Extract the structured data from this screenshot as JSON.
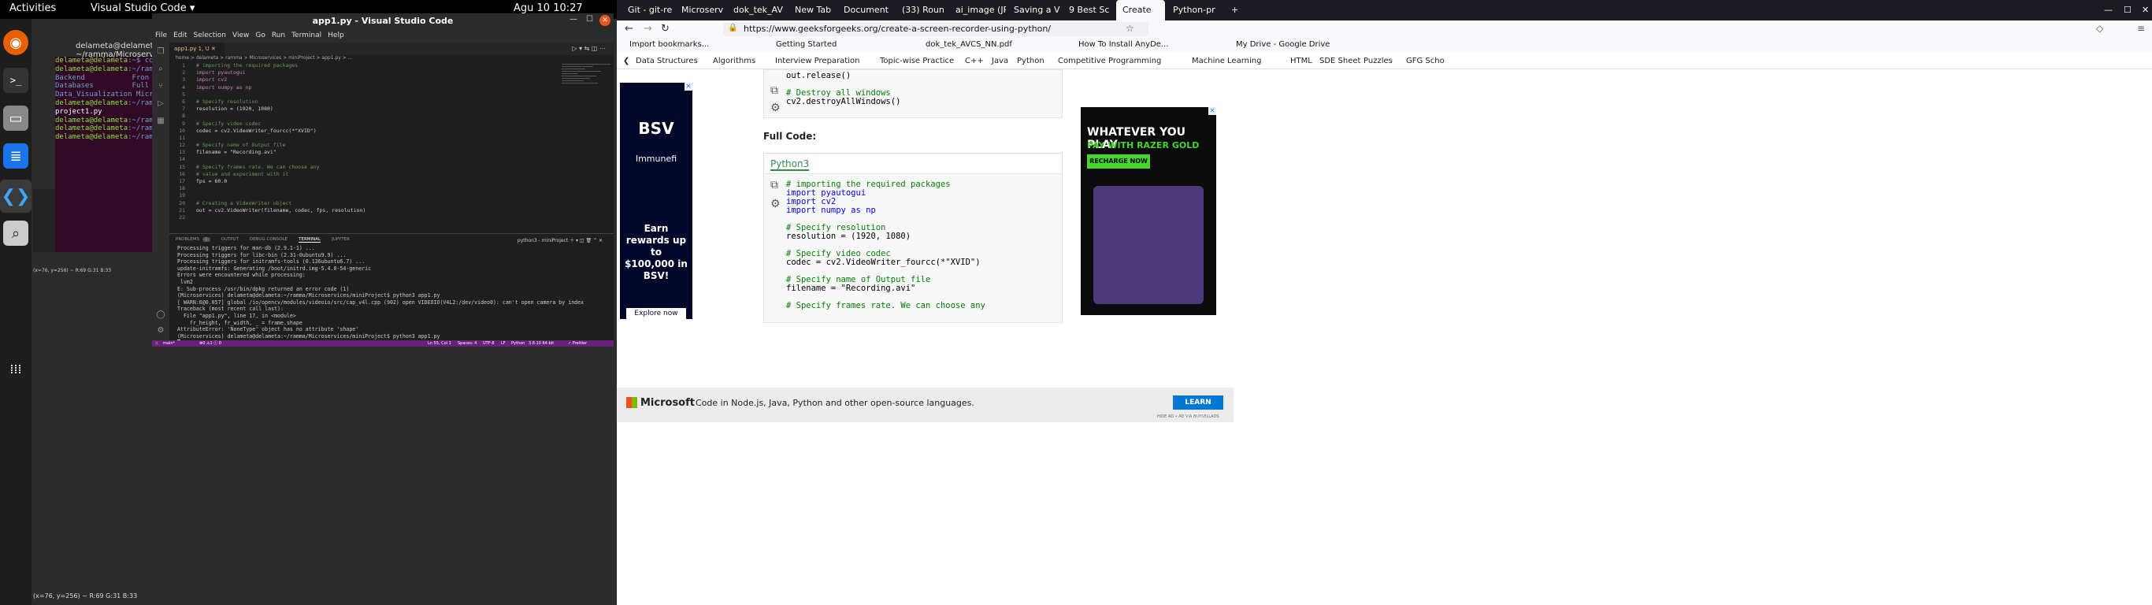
{
  "topbar": {
    "activities": "Activities",
    "app": "Visual Studio Code ▾",
    "clock": "Agu 10  10:27"
  },
  "dock": {
    "apps": [
      "firefox-icon",
      "terminal-icon",
      "files-icon",
      "writer-icon",
      "vscode-icon",
      "search-app-icon",
      "apps-grid-icon"
    ]
  },
  "terminal": {
    "title": "delameta@delameta: ~/ramma/Microservices",
    "lines": [
      {
        "p": "delameta@delameta",
        "s": ":~$ cd"
      },
      {
        "p": "delameta@delameta",
        "s": ":~/ramm"
      },
      {
        "c": "Backend           Fron"
      },
      {
        "c": "Databases         Full"
      },
      {
        "c": "Data_Visualization Micr"
      },
      {
        "p": "delameta@delameta",
        "s": ":~/ramm"
      },
      {
        "t": "project1.py"
      },
      {
        "p": "delameta@delameta",
        "s": ":~/ramm"
      },
      {
        "p": "delameta@delameta",
        "s": ":~/ramm"
      },
      {
        "p": "delameta@delameta",
        "s": ":~/ramm"
      }
    ],
    "coords": "(x=76, y=256) ~ R:69 G:31 B:33"
  },
  "vscode": {
    "title": "app1.py - Visual Studio Code",
    "menu": [
      "File",
      "Edit",
      "Selection",
      "View",
      "Go",
      "Run",
      "Terminal",
      "Help"
    ],
    "tab": "app1.py  1, U",
    "breadcrumb": "home > delameta > ramma > Microservices > miniProject > app1.py > ...",
    "panel_tabs": [
      "PROBLEMS",
      "OUTPUT",
      "DEBUG CONSOLE",
      "TERMINAL",
      "JUPYTER"
    ],
    "panel_count": "1",
    "panel_shell": "python3 - miniProject",
    "terminal_lines": [
      "Processing triggers for man-db (2.9.1-1) ...",
      "Processing triggers for libc-bin (2.31-0ubuntu9.9) ...",
      "Processing triggers for initramfs-tools (0.136ubuntu6.7) ...",
      "update-initramfs: Generating /boot/initrd.img-5.4.0-54-generic",
      "Errors were encountered while processing:",
      " lvm2",
      "E: Sub-process /usr/bin/dpkg returned an error code (1)",
      "(Microservices) delameta@delameta:~/ramma/Microservices/miniProject$ python3 app1.py",
      "[ WARN:0@0.057] global /io/opencv/modules/videoio/src/cap_v4l.cpp (902) open VIDEOIO(V4L2:/dev/video0): can't open camera by index",
      "Traceback (most recent call last):",
      "  File \"app1.py\", line 17, in <module>",
      "    fr_height, fr_width, _ = frame.shape",
      "AttributeError: 'NoneType' object has no attribute 'shape'",
      "(Microservices) delameta@delameta:~/ramma/Microservices/miniProject$ python3 app1.py"
    ],
    "status": {
      "branch": "main*",
      "errors": "⊗0 ⚠1 ⓘ 0",
      "position": "Ln 55, Col 1",
      "spaces": "Spaces: 4",
      "enc": "UTF-8",
      "eol": "LF",
      "lang": "Python",
      "interp": "3.8.10 64-bit",
      "prettier": "✓ Prettier"
    }
  },
  "code": [
    {
      "n": "1",
      "t": "# importing the required packages",
      "k": "cm"
    },
    {
      "n": "2",
      "t": "import pyautogui",
      "k": "imp"
    },
    {
      "n": "3",
      "t": "import cv2",
      "k": "imp"
    },
    {
      "n": "4",
      "t": "import numpy as np",
      "k": "imp"
    },
    {
      "n": "5",
      "t": "",
      "k": "id"
    },
    {
      "n": "6",
      "t": "# Specify resolution",
      "k": "cm"
    },
    {
      "n": "7",
      "t": "resolution = (1920, 1080)",
      "k": "id"
    },
    {
      "n": "8",
      "t": "",
      "k": "id"
    },
    {
      "n": "9",
      "t": "# Specify video codec",
      "k": "cm"
    },
    {
      "n": "10",
      "t": "codec = cv2.VideoWriter_fourcc(*\"XVID\")",
      "k": "id"
    },
    {
      "n": "11",
      "t": "",
      "k": "id"
    },
    {
      "n": "12",
      "t": "# Specify name of Output file",
      "k": "cm"
    },
    {
      "n": "13",
      "t": "filename = \"Recording.avi\"",
      "k": "id"
    },
    {
      "n": "14",
      "t": "",
      "k": "id"
    },
    {
      "n": "15",
      "t": "# Specify frames rate. We can choose any",
      "k": "cm"
    },
    {
      "n": "16",
      "t": "# value and experiment with it",
      "k": "cm"
    },
    {
      "n": "17",
      "t": "fps = 60.0",
      "k": "id"
    },
    {
      "n": "18",
      "t": "",
      "k": "id"
    },
    {
      "n": "19",
      "t": "",
      "k": "id"
    },
    {
      "n": "20",
      "t": "# Creating a VideoWriter object",
      "k": "cm"
    },
    {
      "n": "21",
      "t": "out = cv2.VideoWriter(filename, codec, fps, resolution)",
      "k": "id"
    },
    {
      "n": "22",
      "t": "",
      "k": "id"
    }
  ],
  "browser": {
    "tabs": [
      "Git - git-re",
      "Microserv",
      "dok_tek_AV",
      "New Tab",
      "Document",
      "(33) Roun",
      "ai_image (JP",
      "Saving a V",
      "9 Best Sc",
      "Create",
      "Python-pr"
    ],
    "active_tab": 9,
    "url": "https://www.geeksforgeeks.org/create-a-screen-recorder-using-python/",
    "bookmarks": [
      "Import bookmarks...",
      "Getting Started",
      "dok_tek_AVCS_NN.pdf",
      "How To Install AnyDe...",
      "My Drive - Google Drive"
    ],
    "topics": [
      "Data Structures",
      "Algorithms",
      "Interview Preparation",
      "Topic-wise Practice",
      "C++",
      "Java",
      "Python",
      "Competitive Programming",
      "Machine Learning",
      "HTML",
      "SDE Sheet",
      "Puzzles",
      "GFG Scho"
    ],
    "snippet_top": [
      "out.release()",
      "",
      "# Destroy all windows",
      "cv2.destroyAllWindows()"
    ],
    "full_code_label": "Full Code:",
    "lang_tab": "Python3",
    "snippet": [
      "# importing the required packages",
      "import pyautogui",
      "import cv2",
      "import numpy as np",
      "",
      "# Specify resolution",
      "resolution = (1920, 1080)",
      "",
      "# Specify video codec",
      "codec = cv2.VideoWriter_fourcc(*\"XVID\")",
      "",
      "# Specify name of Output file",
      "filename = \"Recording.avi\"",
      "",
      "# Specify frames rate. We can choose any"
    ],
    "ad_left": {
      "brand": "BSV",
      "partner": "Immunefi",
      "body": "Earn rewards up to $100,000 in BSV!",
      "cta": "Explore now"
    },
    "ad_right": {
      "headline": "WHATEVER YOU PLAY",
      "sub": "PAY WITH RAZER GOLD",
      "cta": "RECHARGE NOW"
    },
    "ms_banner": {
      "brand": "Microsoft",
      "text": "Code in Node.js, Java, Python and other open-source languages.",
      "cta": "LEARN MORE",
      "note": "HIDE AD • AD VIA BUYSELLADS"
    }
  }
}
